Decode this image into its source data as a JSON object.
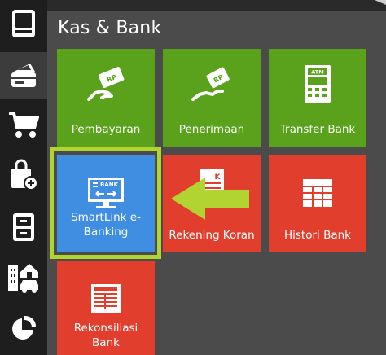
{
  "section": {
    "title": "Kas & Bank"
  },
  "sidebar": {
    "items": [
      {
        "icon": "notebook-icon",
        "active": false
      },
      {
        "icon": "cash-bank-icon",
        "active": true
      },
      {
        "icon": "cart-icon",
        "active": false
      },
      {
        "icon": "shopping-bag-add-icon",
        "active": false
      },
      {
        "icon": "cabinet-icon",
        "active": false
      },
      {
        "icon": "buildings-icon",
        "active": false
      },
      {
        "icon": "pie-chart-icon",
        "active": false
      }
    ]
  },
  "tiles": [
    {
      "label": "Pembayaran",
      "icon": "payment-hand-icon",
      "color": "#5aa21b",
      "badge": "RP"
    },
    {
      "label": "Penerimaan",
      "icon": "receive-hand-icon",
      "color": "#5aa21b",
      "badge": "RP"
    },
    {
      "label": "Transfer Bank",
      "icon": "atm-icon",
      "color": "#5aa21b",
      "badge": "ATM"
    },
    {
      "label": "SmartLink e-Banking",
      "icon": "ebanking-monitor-icon",
      "color": "#3f8ee2",
      "badge": "BANK"
    },
    {
      "label": "Rekening Koran",
      "icon": "bank-statement-icon",
      "color": "#e23e2d",
      "badge": "K"
    },
    {
      "label": "Histori Bank",
      "icon": "grid-table-icon",
      "color": "#e23e2d"
    },
    {
      "label": "Rekonsiliasi Bank",
      "icon": "document-table-icon",
      "color": "#e23e2d"
    }
  ],
  "annotation": {
    "highlight_color": "#b1d431",
    "arrow_color": "#b1d431"
  }
}
